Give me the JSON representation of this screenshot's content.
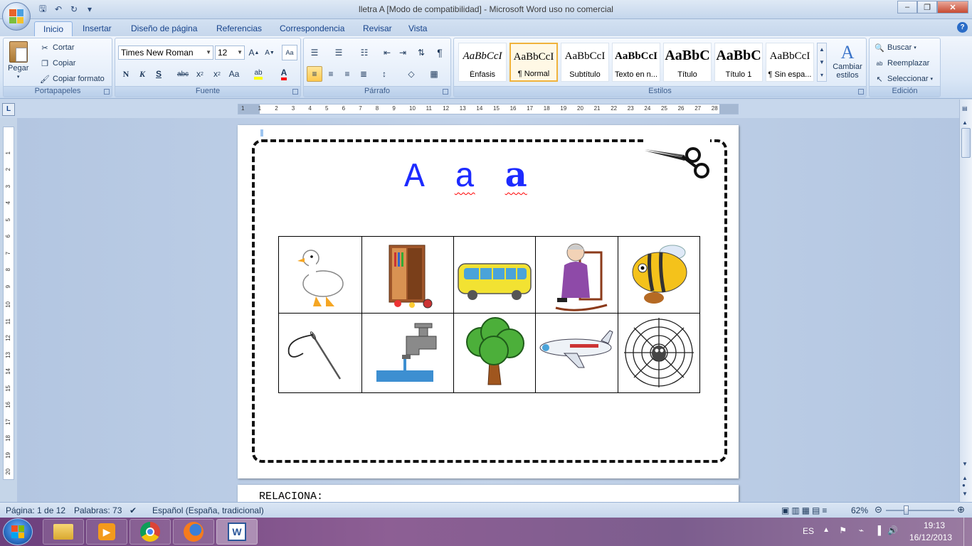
{
  "window": {
    "title": "lletra A [Modo de compatibilidad] - Microsoft Word uso no comercial"
  },
  "tabs": [
    "Inicio",
    "Insertar",
    "Diseño de página",
    "Referencias",
    "Correspondencia",
    "Revisar",
    "Vista"
  ],
  "clipboard": {
    "paste": "Pegar",
    "cut": "Cortar",
    "copy": "Copiar",
    "format_painter": "Copiar formato",
    "label": "Portapapeles"
  },
  "font": {
    "name": "Times New Roman",
    "size": "12",
    "label": "Fuente",
    "bold": "N",
    "italic": "K",
    "underline": "S",
    "strike": "abc",
    "case": "Aa"
  },
  "paragraph": {
    "label": "Párrafo",
    "pilcrow": "¶"
  },
  "styles": {
    "label": "Estilos",
    "items": [
      {
        "sample": "AaBbCcI",
        "name": "Énfasis"
      },
      {
        "sample": "AaBbCcI",
        "name": "¶ Normal"
      },
      {
        "sample": "AaBbCcI",
        "name": "Subtítulo"
      },
      {
        "sample": "AaBbCcI",
        "name": "Texto en n..."
      },
      {
        "sample": "AaBbC",
        "name": "Título"
      },
      {
        "sample": "AaBbC",
        "name": "Título 1"
      },
      {
        "sample": "AaBbCcI",
        "name": "¶ Sin espa..."
      }
    ],
    "change": "Cambiar estilos"
  },
  "editing": {
    "label": "Edición",
    "find": "Buscar",
    "replace": "Reemplazar",
    "select": "Seleccionar"
  },
  "document": {
    "letters": [
      "A",
      "a",
      "a"
    ],
    "page2_text": "RELACIONA:",
    "pictures": [
      "duck",
      "wardrobe",
      "bus",
      "grandmother",
      "bee",
      "needle",
      "faucet",
      "tree",
      "airplane",
      "spider web"
    ]
  },
  "status": {
    "page": "Página: 1 de 12",
    "words": "Palabras: 73",
    "language": "Español (España, tradicional)",
    "zoom": "62%"
  },
  "taskbar": {
    "lang": "ES",
    "time": "19:13",
    "date": "16/12/2013"
  },
  "ruler": {
    "h_ticks": [
      "1",
      "1",
      "2",
      "3",
      "4",
      "5",
      "6",
      "7",
      "8",
      "9",
      "10",
      "11",
      "12",
      "13",
      "14",
      "15",
      "16",
      "17",
      "18",
      "19",
      "20",
      "21",
      "22",
      "23",
      "24",
      "25",
      "26",
      "27",
      "28"
    ]
  }
}
